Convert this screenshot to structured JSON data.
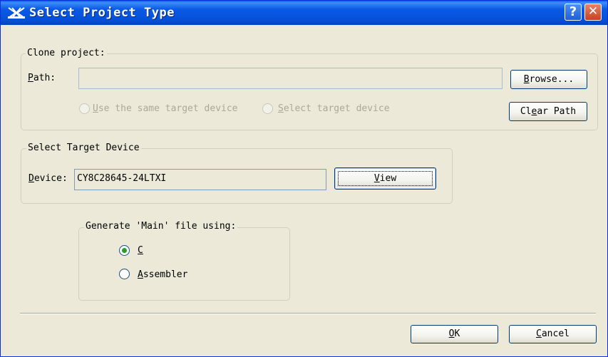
{
  "window": {
    "title": "Select Project Type",
    "icon": "app-logo-icon",
    "help_glyph": "?",
    "close_glyph": "✕"
  },
  "clone_project": {
    "legend": "Clone project:",
    "path_label_u": "P",
    "path_label_rest": "ath:",
    "path_value": "",
    "browse_u": "B",
    "browse_rest": "rowse...",
    "radio_same_u": "U",
    "radio_same_rest": "se the same target device",
    "radio_select_u": "S",
    "radio_select_rest": "elect target device",
    "clear_pre": "Cl",
    "clear_u": "e",
    "clear_rest": "ar Path"
  },
  "target_device": {
    "legend": "Select Target Device",
    "device_label_u": "D",
    "device_label_rest": "evice:",
    "device_value": "CY8C28645-24LTXI",
    "view_u": "V",
    "view_rest": "iew"
  },
  "generate_main": {
    "legend": "Generate 'Main' file using:",
    "options": [
      {
        "u": "C",
        "rest": "",
        "selected": true
      },
      {
        "u": "A",
        "rest": "ssembler",
        "selected": false
      }
    ]
  },
  "footer": {
    "ok_u": "O",
    "ok_rest": "K",
    "cancel_u": "C",
    "cancel_rest": "ancel"
  },
  "colors": {
    "titlebar": "#0A5AE6",
    "dialog_bg": "#ECE9D8",
    "radio_selected": "#21A121"
  }
}
